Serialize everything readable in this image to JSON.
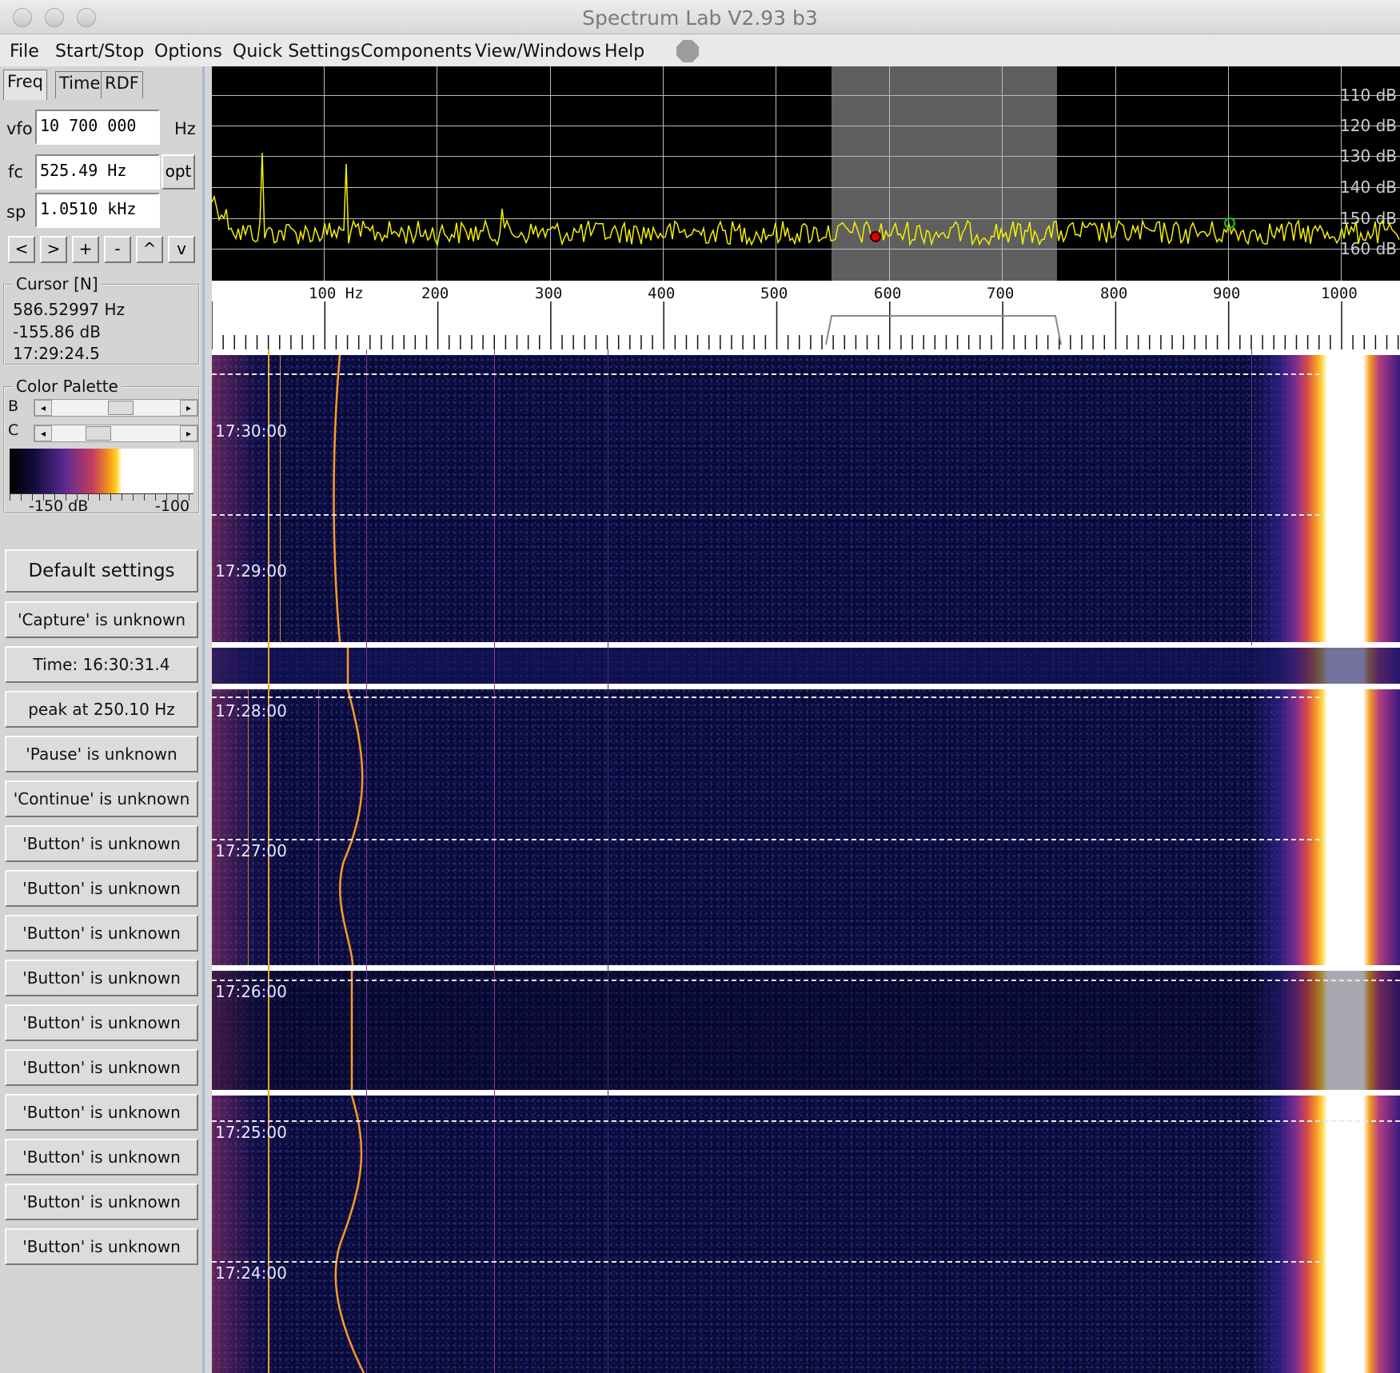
{
  "window": {
    "title": "Spectrum Lab V2.93 b3"
  },
  "menu": {
    "file": "File",
    "start_stop": "Start/Stop",
    "options": "Options",
    "quick_settings": "Quick Settings",
    "components": "Components",
    "view_windows": "View/Windows",
    "help": "Help"
  },
  "tabs": {
    "freq": "Freq",
    "time": "Time",
    "rdf": "RDF"
  },
  "freq_panel": {
    "vfo_label": "vfo",
    "vfo_value": "10 700 000",
    "vfo_unit": "Hz",
    "fc_label": "fc",
    "fc_value": "525.49 Hz",
    "opt_label": "opt",
    "sp_label": "sp",
    "sp_value": "1.0510 kHz",
    "nav_buttons": [
      "<",
      ">",
      "+",
      "-",
      "^",
      "v"
    ]
  },
  "cursor": {
    "title": "Cursor [N]",
    "freq": "586.52997 Hz",
    "level": "-155.86 dB",
    "time": "17:29:24.5"
  },
  "palette": {
    "title": "Color Palette",
    "b_label": "B",
    "c_label": "C",
    "min_label": "-150 dB",
    "max_label": "-100"
  },
  "buttons": {
    "default": "Default settings",
    "capture": "'Capture' is unknown",
    "time": "Time:  16:30:31.4",
    "peak": "peak at 250.10 Hz",
    "pause": "'Pause' is unknown",
    "continue": "'Continue' is unknown",
    "generic": [
      "'Button' is unknown",
      "'Button' is unknown",
      "'Button' is unknown",
      "'Button' is unknown",
      "'Button' is unknown",
      "'Button' is unknown",
      "'Button' is unknown",
      "'Button' is unknown",
      "'Button' is unknown",
      "'Button' is unknown"
    ]
  },
  "spectrum": {
    "db_labels": [
      "110 dB",
      "120 dB",
      "130 dB",
      "140 dB",
      "150 dB",
      "160 dB"
    ],
    "freq_labels": [
      "100 Hz",
      "200",
      "300",
      "400",
      "500",
      "600",
      "700",
      "800",
      "900",
      "1000"
    ]
  },
  "waterfall": {
    "time_labels": [
      "17:30:00",
      "17:29:00",
      "17:28:00",
      "17:27:00",
      "17:26:00",
      "17:25:00",
      "17:24:00"
    ]
  },
  "colors": {
    "spectrum_trace": "#f4f000",
    "waterfall_bg": "#0b0d40",
    "carrier_line": "#ff9a2a",
    "palette_gradient": [
      "#000000",
      "#1a1050",
      "#6a2a90",
      "#c23a60",
      "#f08a20",
      "#ffd020",
      "#ffffff"
    ]
  }
}
